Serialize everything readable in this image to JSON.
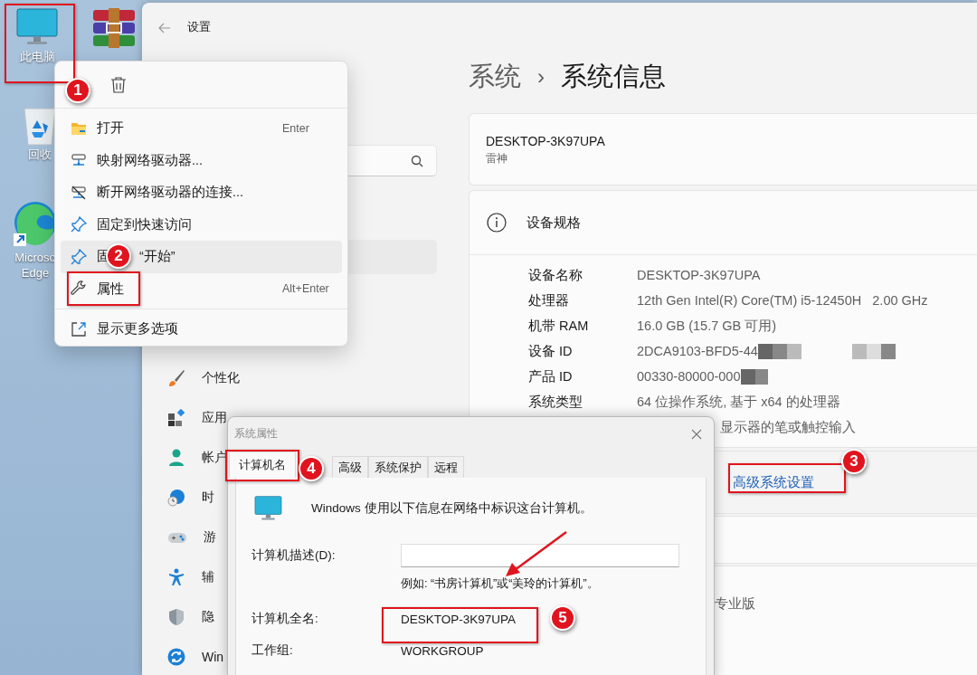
{
  "desktop": {
    "icons": [
      {
        "kind": "computer",
        "lines": [
          "此电脑"
        ]
      },
      {
        "kind": "archive"
      },
      {
        "kind": "recycle",
        "lines": [
          "回收"
        ]
      },
      {
        "kind": "edge",
        "lines": [
          "Microso",
          "Edge"
        ]
      }
    ]
  },
  "settings": {
    "title": "设置",
    "nav": [
      {
        "kind": "brush",
        "label": "个性化"
      },
      {
        "kind": "apps",
        "label": "应用"
      },
      {
        "kind": "account",
        "label": "帐户"
      },
      {
        "kind": "time",
        "label": "时"
      },
      {
        "kind": "gaming",
        "label": "游"
      },
      {
        "kind": "accessibility",
        "label": "辅"
      },
      {
        "kind": "privacy",
        "label": "隐"
      },
      {
        "kind": "update",
        "label": "Win"
      }
    ],
    "breadcrumb": {
      "parent": "系统",
      "separator": "›",
      "current": "系统信息"
    },
    "device": {
      "name": "DESKTOP-3K97UPA",
      "model": "雷神"
    },
    "specs": {
      "title": "设备规格",
      "rows": [
        {
          "label": "设备名称",
          "value": "DESKTOP-3K97UPA",
          "redacted": false
        },
        {
          "label": "处理器",
          "value": "12th Gen Intel(R) Core(TM) i5-12450H   2.00 GHz",
          "redacted": false
        },
        {
          "label": "机带 RAM",
          "value": "16.0 GB (15.7 GB 可用)",
          "redacted": false
        },
        {
          "label": "设备 ID",
          "value": "2DCA9103-BFD5-44",
          "redacted": true
        },
        {
          "label": "产品 ID",
          "value": "00330-80000-000",
          "redacted": true
        },
        {
          "label": "系统类型",
          "value": "64 位操作系统, 基于 x64 的处理器",
          "redacted": false
        },
        {
          "value": "显示器的笔或触控输入",
          "redacted": false
        }
      ]
    },
    "related_link": "高级系统设置",
    "edition": "专业版"
  },
  "context_menu": {
    "groups": [
      [
        {
          "kind": "folder",
          "label": "打开",
          "shortcut": "Enter",
          "highlighted": false
        },
        {
          "kind": "drive",
          "label": "映射网络驱动器...",
          "highlighted": false
        },
        {
          "kind": "drive-off",
          "label": "断开网络驱动器的连接...",
          "highlighted": false
        },
        {
          "kind": "pin",
          "label": "固定到快速访问",
          "highlighted": false
        },
        {
          "kind": "pin",
          "label_parts": [
            "固",
            "“开始”"
          ],
          "highlighted": true
        },
        {
          "kind": "wrench",
          "label": "属性",
          "shortcut": "Alt+Enter",
          "highlighted": false
        }
      ],
      [
        {
          "kind": "share",
          "label": "显示更多选项",
          "highlighted": false
        }
      ]
    ]
  },
  "dialog": {
    "title": "系统属性",
    "tabs": [
      {
        "label": "计算机名",
        "selected": true
      },
      {
        "label": "高级",
        "selected": false
      },
      {
        "label": "系统保护",
        "selected": false
      },
      {
        "label": "远程",
        "selected": false
      }
    ],
    "intro": "Windows 使用以下信息在网络中标识这台计算机。",
    "fields": [
      {
        "kind": "input",
        "label": "计算机描述(D):",
        "note": "例如: “书房计算机”或“美玲的计算机”。"
      },
      {
        "kind": "text",
        "label": "计算机全名:",
        "value": "DESKTOP-3K97UPA"
      },
      {
        "kind": "text",
        "label": "工作组:",
        "value": "WORKGROUP"
      }
    ]
  },
  "annotations": {
    "markers": [
      {
        "label": "1"
      },
      {
        "label": "2"
      },
      {
        "label": "3"
      },
      {
        "label": "4"
      },
      {
        "label": "5"
      }
    ]
  }
}
